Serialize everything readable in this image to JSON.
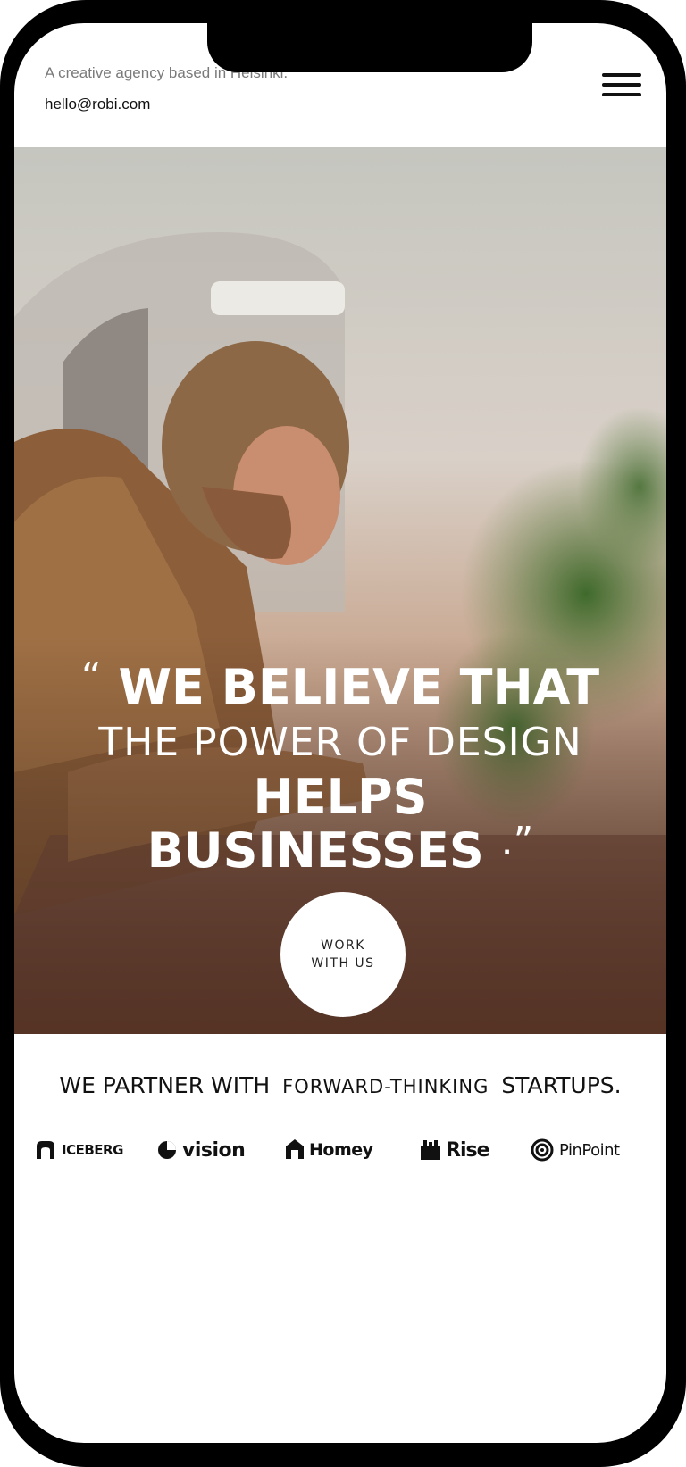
{
  "header": {
    "tagline": "A creative agency based in Helsinki.",
    "email": "hello@robi.com",
    "menu_icon": "hamburger-menu-icon"
  },
  "hero": {
    "open_quote": "“",
    "line1": "WE BELIEVE THAT",
    "line2": "THE POWER OF DESIGN",
    "line3": "HELPS",
    "line4": "BUSINESSES",
    "close_quote": ".”",
    "cta_line1": "WORK",
    "cta_line2": "WITH US"
  },
  "partners": {
    "title_part1": "WE PARTNER WITH",
    "title_part2": "FORWARD-THINKING",
    "title_part3": "STARTUPS.",
    "logos": [
      {
        "name": "ICEBERG",
        "icon": "iceberg-icon"
      },
      {
        "name": "vision",
        "icon": "vision-icon"
      },
      {
        "name": "Homey",
        "icon": "homey-icon"
      },
      {
        "name": "Rise",
        "icon": "rise-icon"
      },
      {
        "name": "PinPoint",
        "icon": "pinpoint-icon"
      }
    ]
  },
  "colors": {
    "frame": "#000000",
    "background": "#ffffff",
    "hero_text": "#ffffff",
    "text_primary": "#111111",
    "text_muted": "#7a7a7a"
  }
}
